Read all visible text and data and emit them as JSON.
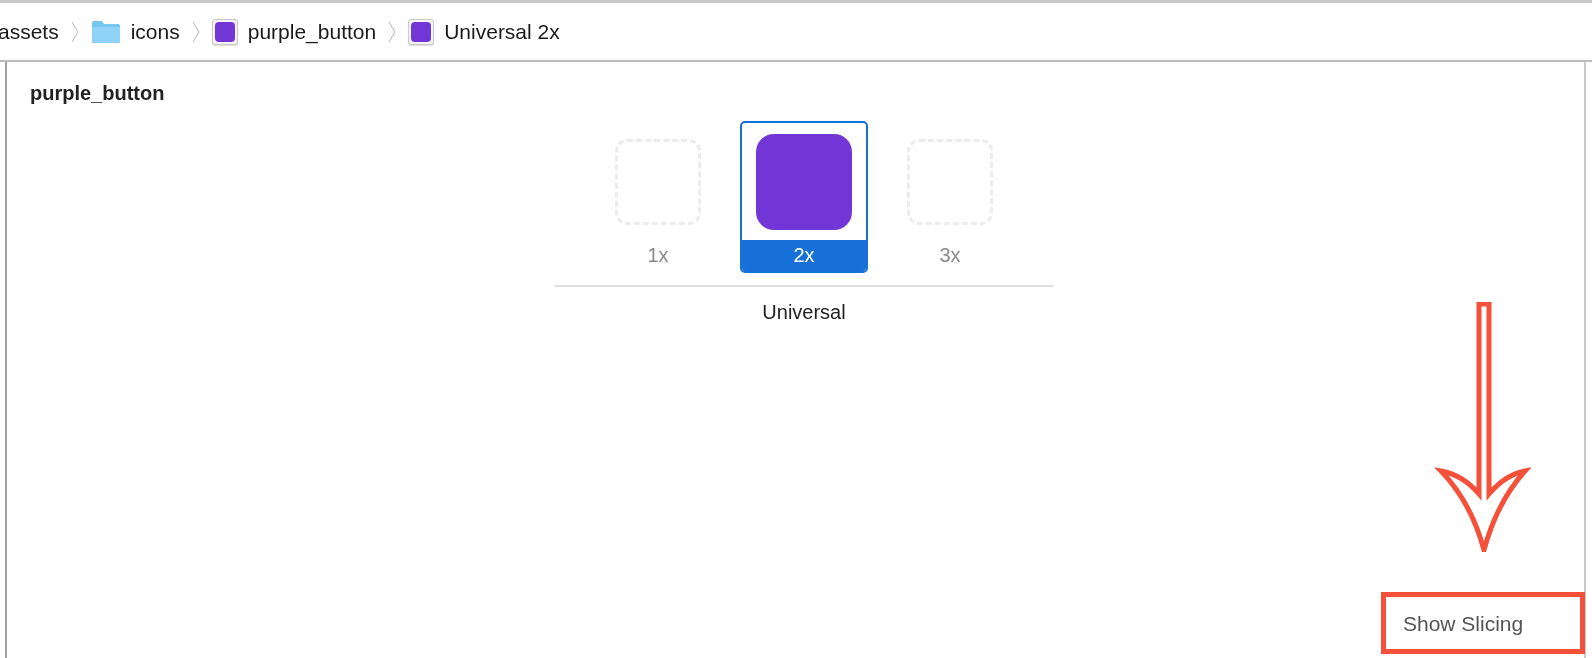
{
  "breadcrumb": [
    {
      "label": "assets",
      "kind": "plain"
    },
    {
      "label": "icons",
      "kind": "folder"
    },
    {
      "label": "purple_button",
      "kind": "image"
    },
    {
      "label": "Universal 2x",
      "kind": "image"
    }
  ],
  "asset": {
    "name": "purple_button",
    "group_label": "Universal",
    "slots": [
      {
        "label": "1x",
        "selected": false,
        "filled": false
      },
      {
        "label": "2x",
        "selected": true,
        "filled": true
      },
      {
        "label": "3x",
        "selected": false,
        "filled": false
      }
    ]
  },
  "slicing_button": {
    "label": "Show Slicing"
  }
}
